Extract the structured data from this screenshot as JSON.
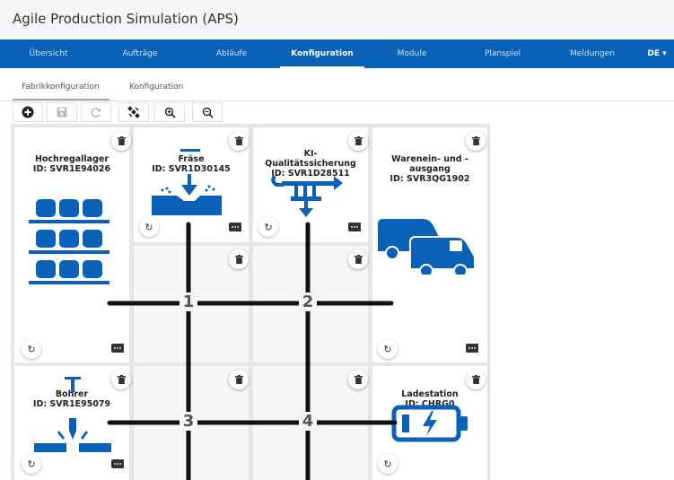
{
  "app": {
    "title": "Agile Production Simulation (APS)"
  },
  "nav": {
    "items": [
      "Übersicht",
      "Aufträge",
      "Abläufe",
      "Konfiguration",
      "Module",
      "Planspiel",
      "Meldungen"
    ],
    "active": "Konfiguration",
    "lang": "DE ▾"
  },
  "subtabs": [
    "Fabrikkonfiguration",
    "Konfiguration"
  ],
  "modules": [
    {
      "name": "Hochregallager",
      "id": "ID: SVR1E94026"
    },
    {
      "name": "Fräse",
      "id": "ID: SVR1D30145"
    },
    {
      "name": "KI-\nQualitätssicherung",
      "id": "ID: SVR1D28511"
    },
    {
      "name": "Warenein- und -\nausgang",
      "id": "ID: SVR3QG1902"
    },
    {
      "name": "Bohrer",
      "id": "ID: SVR1E95079"
    },
    {
      "name": "Ladestation",
      "id": "ID: CHRG0"
    }
  ],
  "junctions": [
    "1",
    "2",
    "3",
    "4"
  ],
  "colors": {
    "brand": "#0a62b8",
    "track": "#111111"
  }
}
